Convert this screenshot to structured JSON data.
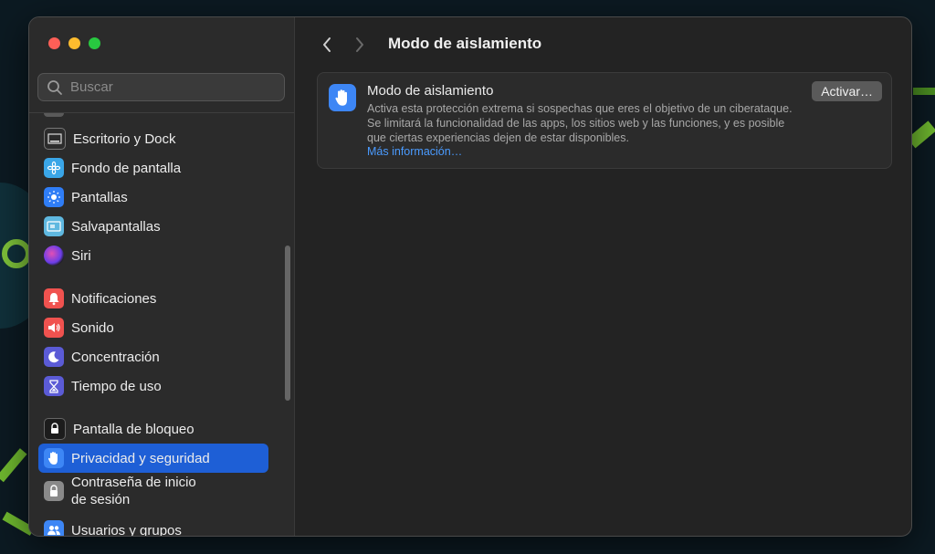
{
  "search": {
    "placeholder": "Buscar"
  },
  "sidebar": {
    "items": [
      {
        "label": "Escritorio y Dock",
        "icon": "dock-icon",
        "color": "#2c2c2c"
      },
      {
        "label": "Fondo de pantalla",
        "icon": "wallpaper-flower-icon",
        "color": "#3aa6e8"
      },
      {
        "label": "Pantallas",
        "icon": "sun-icon",
        "color": "#2f7df6"
      },
      {
        "label": "Salvapantallas",
        "icon": "screensaver-icon",
        "color": "#5fb8e0"
      },
      {
        "label": "Siri",
        "icon": "siri-icon",
        "color": "#1a1a1a"
      },
      {
        "label": "Notificaciones",
        "icon": "bell-icon",
        "color": "#f0524f"
      },
      {
        "label": "Sonido",
        "icon": "speaker-icon",
        "color": "#f0524f"
      },
      {
        "label": "Concentración",
        "icon": "moon-icon",
        "color": "#5b5bd6"
      },
      {
        "label": "Tiempo de uso",
        "icon": "hourglass-icon",
        "color": "#5b5bd6"
      },
      {
        "label": "Pantalla de bloqueo",
        "icon": "lock-icon",
        "color": "#1c1c1c"
      },
      {
        "label": "Privacidad y seguridad",
        "icon": "hand-icon",
        "color": "#3d86f5",
        "selected": true
      },
      {
        "label": "Contraseña de inicio de sesión",
        "label_line1": "Contraseña de inicio",
        "label_line2": "de sesión",
        "icon": "padlock-icon",
        "color": "#8a8a8a"
      },
      {
        "label": "Usuarios y grupos",
        "icon": "users-icon",
        "color": "#3d86f5"
      }
    ]
  },
  "header": {
    "title": "Modo de aislamiento"
  },
  "card": {
    "title": "Modo de aislamiento",
    "description": "Activa esta protección extrema si sospechas que eres el objetivo de un ciberataque. Se limitará la funcionalidad de las apps, los sitios web y las funciones, y es posible que ciertas experiencias dejen de estar disponibles.",
    "link": "Más información…",
    "button": "Activar…"
  }
}
